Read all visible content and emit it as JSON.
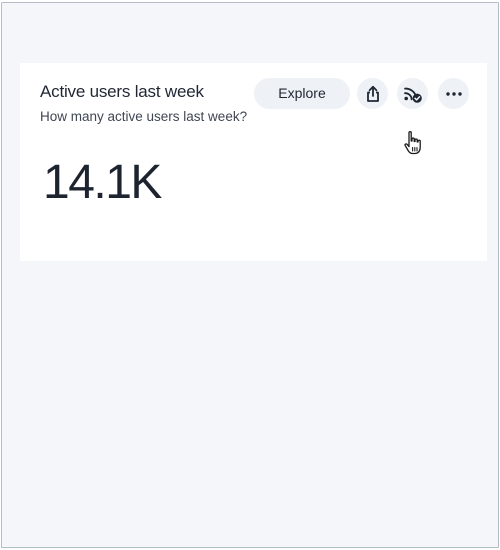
{
  "card": {
    "title": "Active users last week",
    "subtitle": "How many active users last week?",
    "kpi_value": "14.1K"
  },
  "toolbar": {
    "explore_label": "Explore",
    "icons": [
      "share-icon",
      "subscribe-icon",
      "more-icon"
    ]
  },
  "colors": {
    "background": "#f4f6f9",
    "card": "#ffffff",
    "button_bg": "#eef1f5",
    "text": "#1f2733"
  }
}
